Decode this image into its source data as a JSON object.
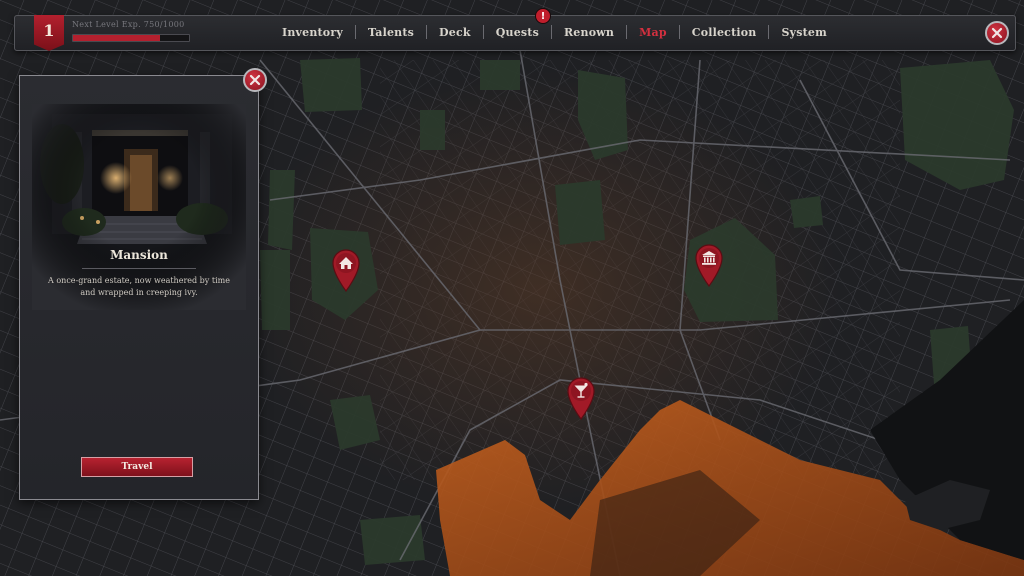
{
  "player": {
    "level": "1",
    "exp_label": "Next Level Exp. 750/1000",
    "exp_progress": 0.75
  },
  "nav": {
    "items": [
      {
        "label": "Inventory",
        "active": false
      },
      {
        "label": "Talents",
        "active": false
      },
      {
        "label": "Deck",
        "active": false
      },
      {
        "label": "Quests",
        "active": false
      },
      {
        "label": "Renown",
        "active": false
      },
      {
        "label": "Map",
        "active": true
      },
      {
        "label": "Collection",
        "active": false
      },
      {
        "label": "System",
        "active": false
      }
    ],
    "alert_glyph": "!"
  },
  "location": {
    "title": "Mansion",
    "description": "A once-grand estate, now weathered by time and wrapped in creeping ivy.",
    "action": "Travel"
  },
  "markers": [
    {
      "name": "mansion",
      "icon": "house-icon"
    },
    {
      "name": "temple",
      "icon": "temple-icon"
    },
    {
      "name": "bar",
      "icon": "cocktail-icon"
    }
  ],
  "colors": {
    "accent": "#b3202e",
    "active_tab": "#d3303f",
    "map_bg": "#1b1c1f",
    "park": "#2b3a2c",
    "water": "#b9561f"
  }
}
